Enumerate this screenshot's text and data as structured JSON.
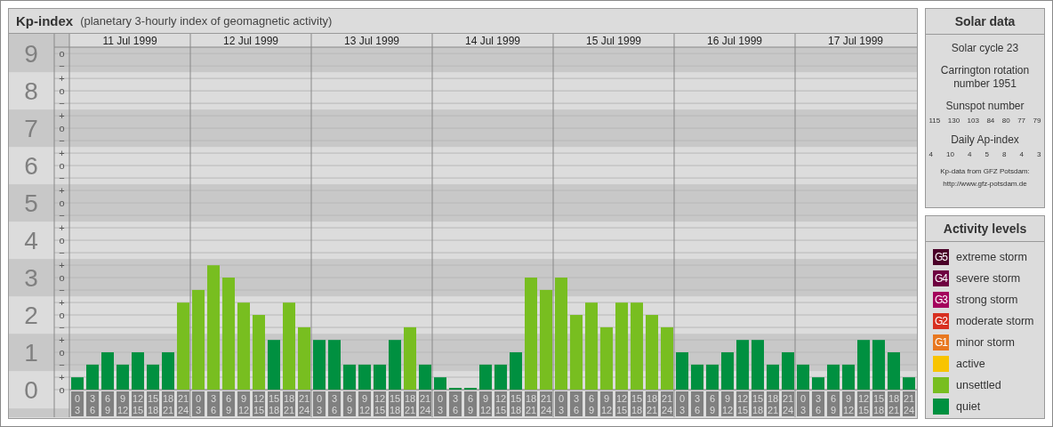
{
  "header": {
    "title": "Kp-index",
    "subtitle": "(planetary 3-hourly index of geomagnetic activity)"
  },
  "kp_chart": {
    "days": [
      "11 Jul 1999",
      "12 Jul 1999",
      "13 Jul 1999",
      "14 Jul 1999",
      "15 Jul 1999",
      "16 Jul 1999",
      "17 Jul 1999"
    ],
    "minor_ticks": [
      "o",
      "−",
      "+",
      "o",
      "−",
      "+",
      "o",
      "−",
      "+",
      "o",
      "−",
      "+",
      "o",
      "−",
      "+",
      "o",
      "−",
      "+",
      "o",
      "−",
      "+",
      "o",
      "−",
      "+",
      "o",
      "−",
      "+",
      "o"
    ],
    "chart_data": {
      "type": "bar",
      "grid": true,
      "ylim": [
        0,
        9.17
      ],
      "yticks": [
        {
          "value": 9,
          "label": "9"
        },
        {
          "value": 8,
          "label": "8"
        },
        {
          "value": 7,
          "label": "7"
        },
        {
          "value": 6,
          "label": "6"
        },
        {
          "value": 5,
          "label": "5"
        },
        {
          "value": 4,
          "label": "4"
        },
        {
          "value": 3,
          "label": "3"
        },
        {
          "value": 2,
          "label": "2"
        },
        {
          "value": 1,
          "label": "1"
        },
        {
          "value": 0,
          "label": "0"
        }
      ],
      "categories": [
        "0 3",
        "3 6",
        "6 9",
        "9 12",
        "12 15",
        "15 18",
        "18 21",
        "21 24",
        "0 3",
        "3 6",
        "6 9",
        "9 12",
        "12 15",
        "15 18",
        "18 21",
        "21 24",
        "0 3",
        "3 6",
        "6 9",
        "9 12",
        "12 15",
        "15 18",
        "18 21",
        "21 24",
        "0 3",
        "3 6",
        "6 9",
        "9 12",
        "12 15",
        "15 18",
        "18 21",
        "21 24",
        "0 3",
        "3 6",
        "6 9",
        "9 12",
        "12 15",
        "15 18",
        "18 21",
        "21 24",
        "0 3",
        "3 6",
        "6 9",
        "9 12",
        "12 15",
        "15 18",
        "18 21",
        "21 24",
        "0 3",
        "3 6",
        "6 9",
        "9 12",
        "12 15",
        "15 18",
        "18 21",
        "21 24"
      ],
      "series": [
        {
          "color": "#009040",
          "values": [
            0.33,
            0.67,
            1,
            0.67,
            1,
            0.67,
            1,
            null,
            null,
            null,
            null,
            null,
            null,
            1.33,
            null,
            null,
            1.33,
            1.33,
            0.67,
            0.67,
            0.67,
            1.33,
            null,
            0.67,
            0.33,
            0,
            0,
            0.67,
            0.67,
            1,
            null,
            null,
            null,
            null,
            null,
            null,
            null,
            null,
            null,
            null,
            1,
            0.67,
            0.67,
            1,
            1.33,
            1.33,
            0.67,
            1,
            0.67,
            0.33,
            0.67,
            0.67,
            1.33,
            1.33,
            1,
            0.33
          ]
        },
        {
          "color": "#78be20",
          "values": [
            null,
            null,
            null,
            null,
            null,
            null,
            null,
            2.33,
            2.67,
            3.33,
            3,
            2.33,
            2,
            null,
            2.33,
            1.67,
            null,
            null,
            null,
            null,
            null,
            null,
            1.67,
            null,
            null,
            null,
            null,
            null,
            null,
            null,
            3,
            2.67,
            3,
            2,
            2.33,
            1.67,
            2.33,
            2.33,
            2,
            1.67,
            null,
            null,
            null,
            null,
            null,
            null,
            null,
            null,
            null,
            null,
            null,
            null,
            null,
            null,
            null,
            null
          ]
        }
      ]
    }
  },
  "solar_data": {
    "title": "Solar data",
    "cycle": "Solar cycle 23",
    "carrington": "Carrington rotation number 1951",
    "sunspot_heading": "Sunspot number",
    "sunspot_numbers": [
      "115",
      "130",
      "103",
      "84",
      "80",
      "77",
      "79"
    ],
    "ap_heading": "Daily Ap-index",
    "ap_values": [
      "4",
      "10",
      "4",
      "5",
      "8",
      "4",
      "3"
    ],
    "source_lines": [
      "Kp-data from GFZ Potsdam:",
      "http://www.gfz-potsdam.de"
    ]
  },
  "activity_levels": {
    "title": "Activity levels",
    "items": [
      {
        "badge": "G5",
        "label": "extreme storm",
        "color": "#4a0028"
      },
      {
        "badge": "G4",
        "label": "severe storm",
        "color": "#6e0040"
      },
      {
        "badge": "G3",
        "label": "strong storm",
        "color": "#a4005c"
      },
      {
        "badge": "G2",
        "label": "moderate storm",
        "color": "#d83020"
      },
      {
        "badge": "G1",
        "label": "minor storm",
        "color": "#e87820"
      },
      {
        "label": "active",
        "color": "#f8c400"
      },
      {
        "label": "unsettled",
        "color": "#78be20"
      },
      {
        "label": "quiet",
        "color": "#009040"
      }
    ]
  }
}
